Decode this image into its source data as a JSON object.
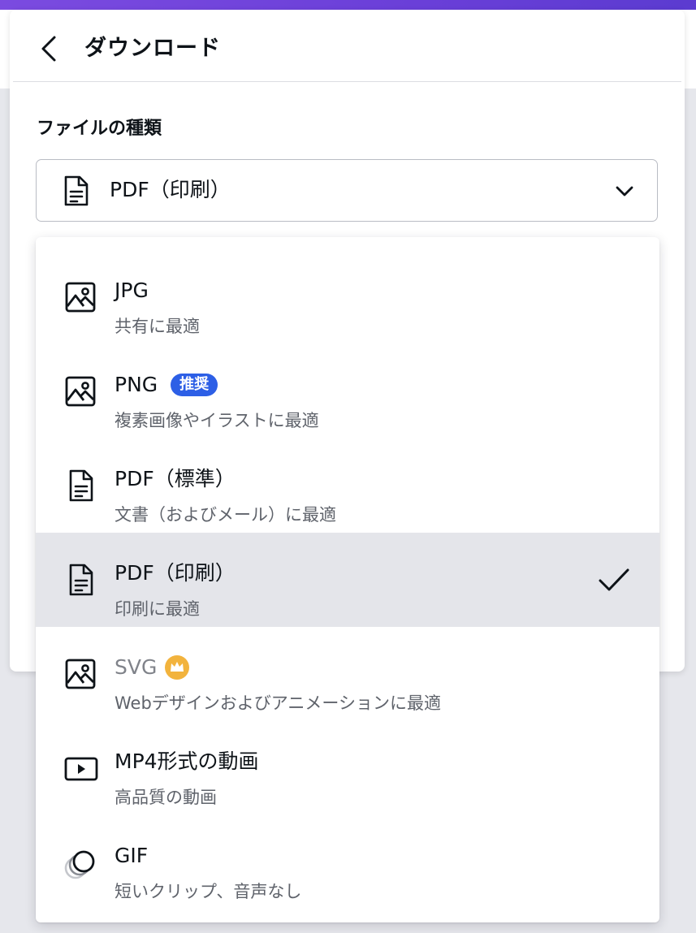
{
  "header": {
    "title": "ダウンロード"
  },
  "file_type": {
    "label": "ファイルの種類",
    "selected": "PDF（印刷）"
  },
  "options": [
    {
      "title": "JPG",
      "subtitle": "共有に最適",
      "icon": "image-icon"
    },
    {
      "title": "PNG",
      "badge": "推奨",
      "subtitle": "複素画像やイラストに最適",
      "icon": "image-icon"
    },
    {
      "title": "PDF（標準）",
      "subtitle": "文書（およびメール）に最適",
      "icon": "document-icon"
    },
    {
      "title": "PDF（印刷）",
      "subtitle": "印刷に最適",
      "icon": "document-icon",
      "selected": true
    },
    {
      "title": "SVG",
      "subtitle": "Webデザインおよびアニメーションに最適",
      "icon": "image-icon",
      "premium": true
    },
    {
      "title": "MP4形式の動画",
      "subtitle": "高品質の動画",
      "icon": "video-icon"
    },
    {
      "title": "GIF",
      "subtitle": "短いクリップ、音声なし",
      "icon": "gif-icon"
    }
  ],
  "colors": {
    "accent_purple": "#6a3fd8",
    "badge_blue": "#2d5fe6",
    "crown_gold": "#f2b33d",
    "selected_bg": "#e4e5ea"
  }
}
